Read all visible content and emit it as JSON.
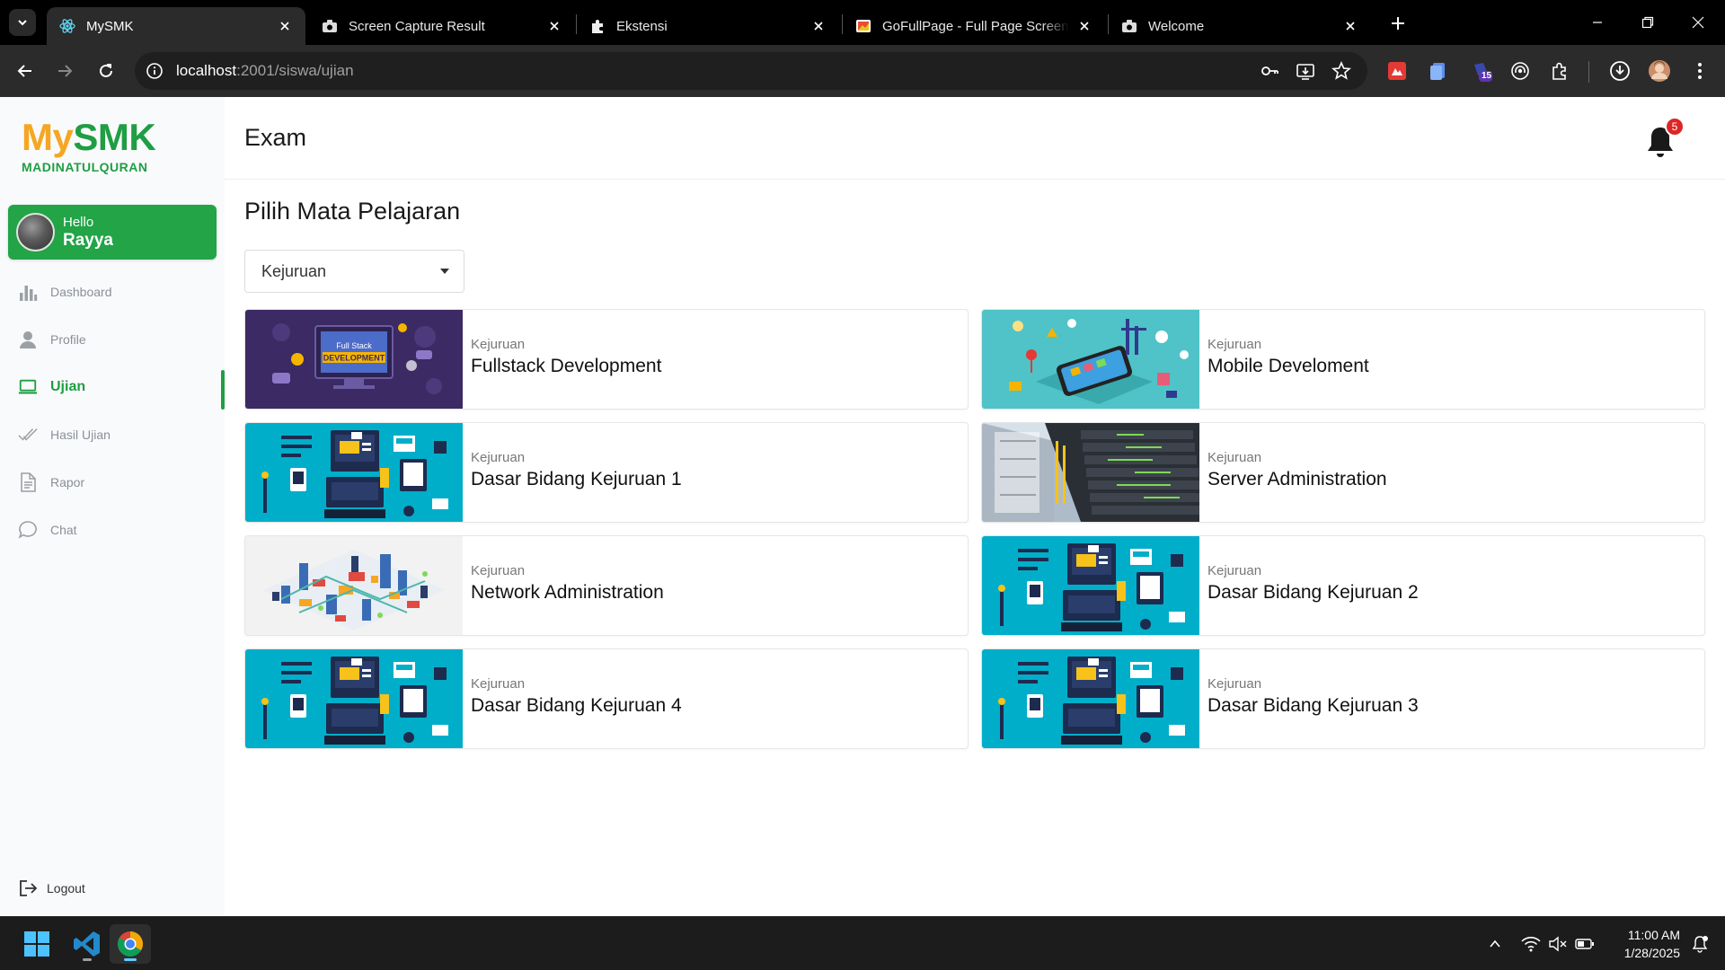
{
  "browser": {
    "tabs": [
      {
        "title": "MySMK",
        "icon": "react-icon",
        "active": true
      },
      {
        "title": "Screen Capture Result",
        "icon": "camera-icon",
        "active": false
      },
      {
        "title": "Ekstensi",
        "icon": "puzzle-icon",
        "active": false
      },
      {
        "title": "GoFullPage - Full Page Screen Capture",
        "icon": "gofullpage-icon",
        "active": false
      },
      {
        "title": "Welcome",
        "icon": "camera-icon",
        "active": false
      }
    ],
    "url_host": "localhost",
    "url_rest": ":2001/siswa/ujian",
    "extension_badge": "15"
  },
  "app": {
    "logo_my": "My",
    "logo_smk": "SMK",
    "logo_sub": "MADINATULQURAN",
    "colors": {
      "brand_green": "#1f9e43",
      "brand_orange": "#f5a623",
      "badge_red": "#dc2626"
    },
    "greeting": "Hello",
    "user_name": "Rayya",
    "nav": [
      {
        "label": "Dashboard",
        "icon": "bar-chart-icon",
        "active": false
      },
      {
        "label": "Profile",
        "icon": "user-icon",
        "active": false
      },
      {
        "label": "Ujian",
        "icon": "laptop-icon",
        "active": true
      },
      {
        "label": "Hasil Ujian",
        "icon": "check-marks-icon",
        "active": false
      },
      {
        "label": "Rapor",
        "icon": "document-icon",
        "active": false
      },
      {
        "label": "Chat",
        "icon": "chat-bubble-icon",
        "active": false
      }
    ],
    "logout_label": "Logout"
  },
  "page": {
    "title": "Exam",
    "notification_count": "5",
    "section_title": "Pilih Mata Pelajaran",
    "select_value": "Kejuruan",
    "subjects": [
      {
        "category": "Kejuruan",
        "name": "Fullstack Development",
        "thumb_text_1": "Full Stack",
        "thumb_text_2": "DEVELOPMENT",
        "thumb": "fullstack"
      },
      {
        "category": "Kejuruan",
        "name": "Mobile Develoment",
        "thumb": "mobile"
      },
      {
        "category": "Kejuruan",
        "name": "Dasar Bidang Kejuruan 1",
        "thumb": "desk"
      },
      {
        "category": "Kejuruan",
        "name": "Server Administration",
        "thumb": "server"
      },
      {
        "category": "Kejuruan",
        "name": "Network Administration",
        "thumb": "network"
      },
      {
        "category": "Kejuruan",
        "name": "Dasar Bidang Kejuruan 2",
        "thumb": "desk"
      },
      {
        "category": "Kejuruan",
        "name": "Dasar Bidang Kejuruan 4",
        "thumb": "desk"
      },
      {
        "category": "Kejuruan",
        "name": "Dasar Bidang Kejuruan 3",
        "thumb": "desk"
      }
    ]
  },
  "taskbar": {
    "time": "11:00 AM",
    "date": "1/28/2025"
  }
}
